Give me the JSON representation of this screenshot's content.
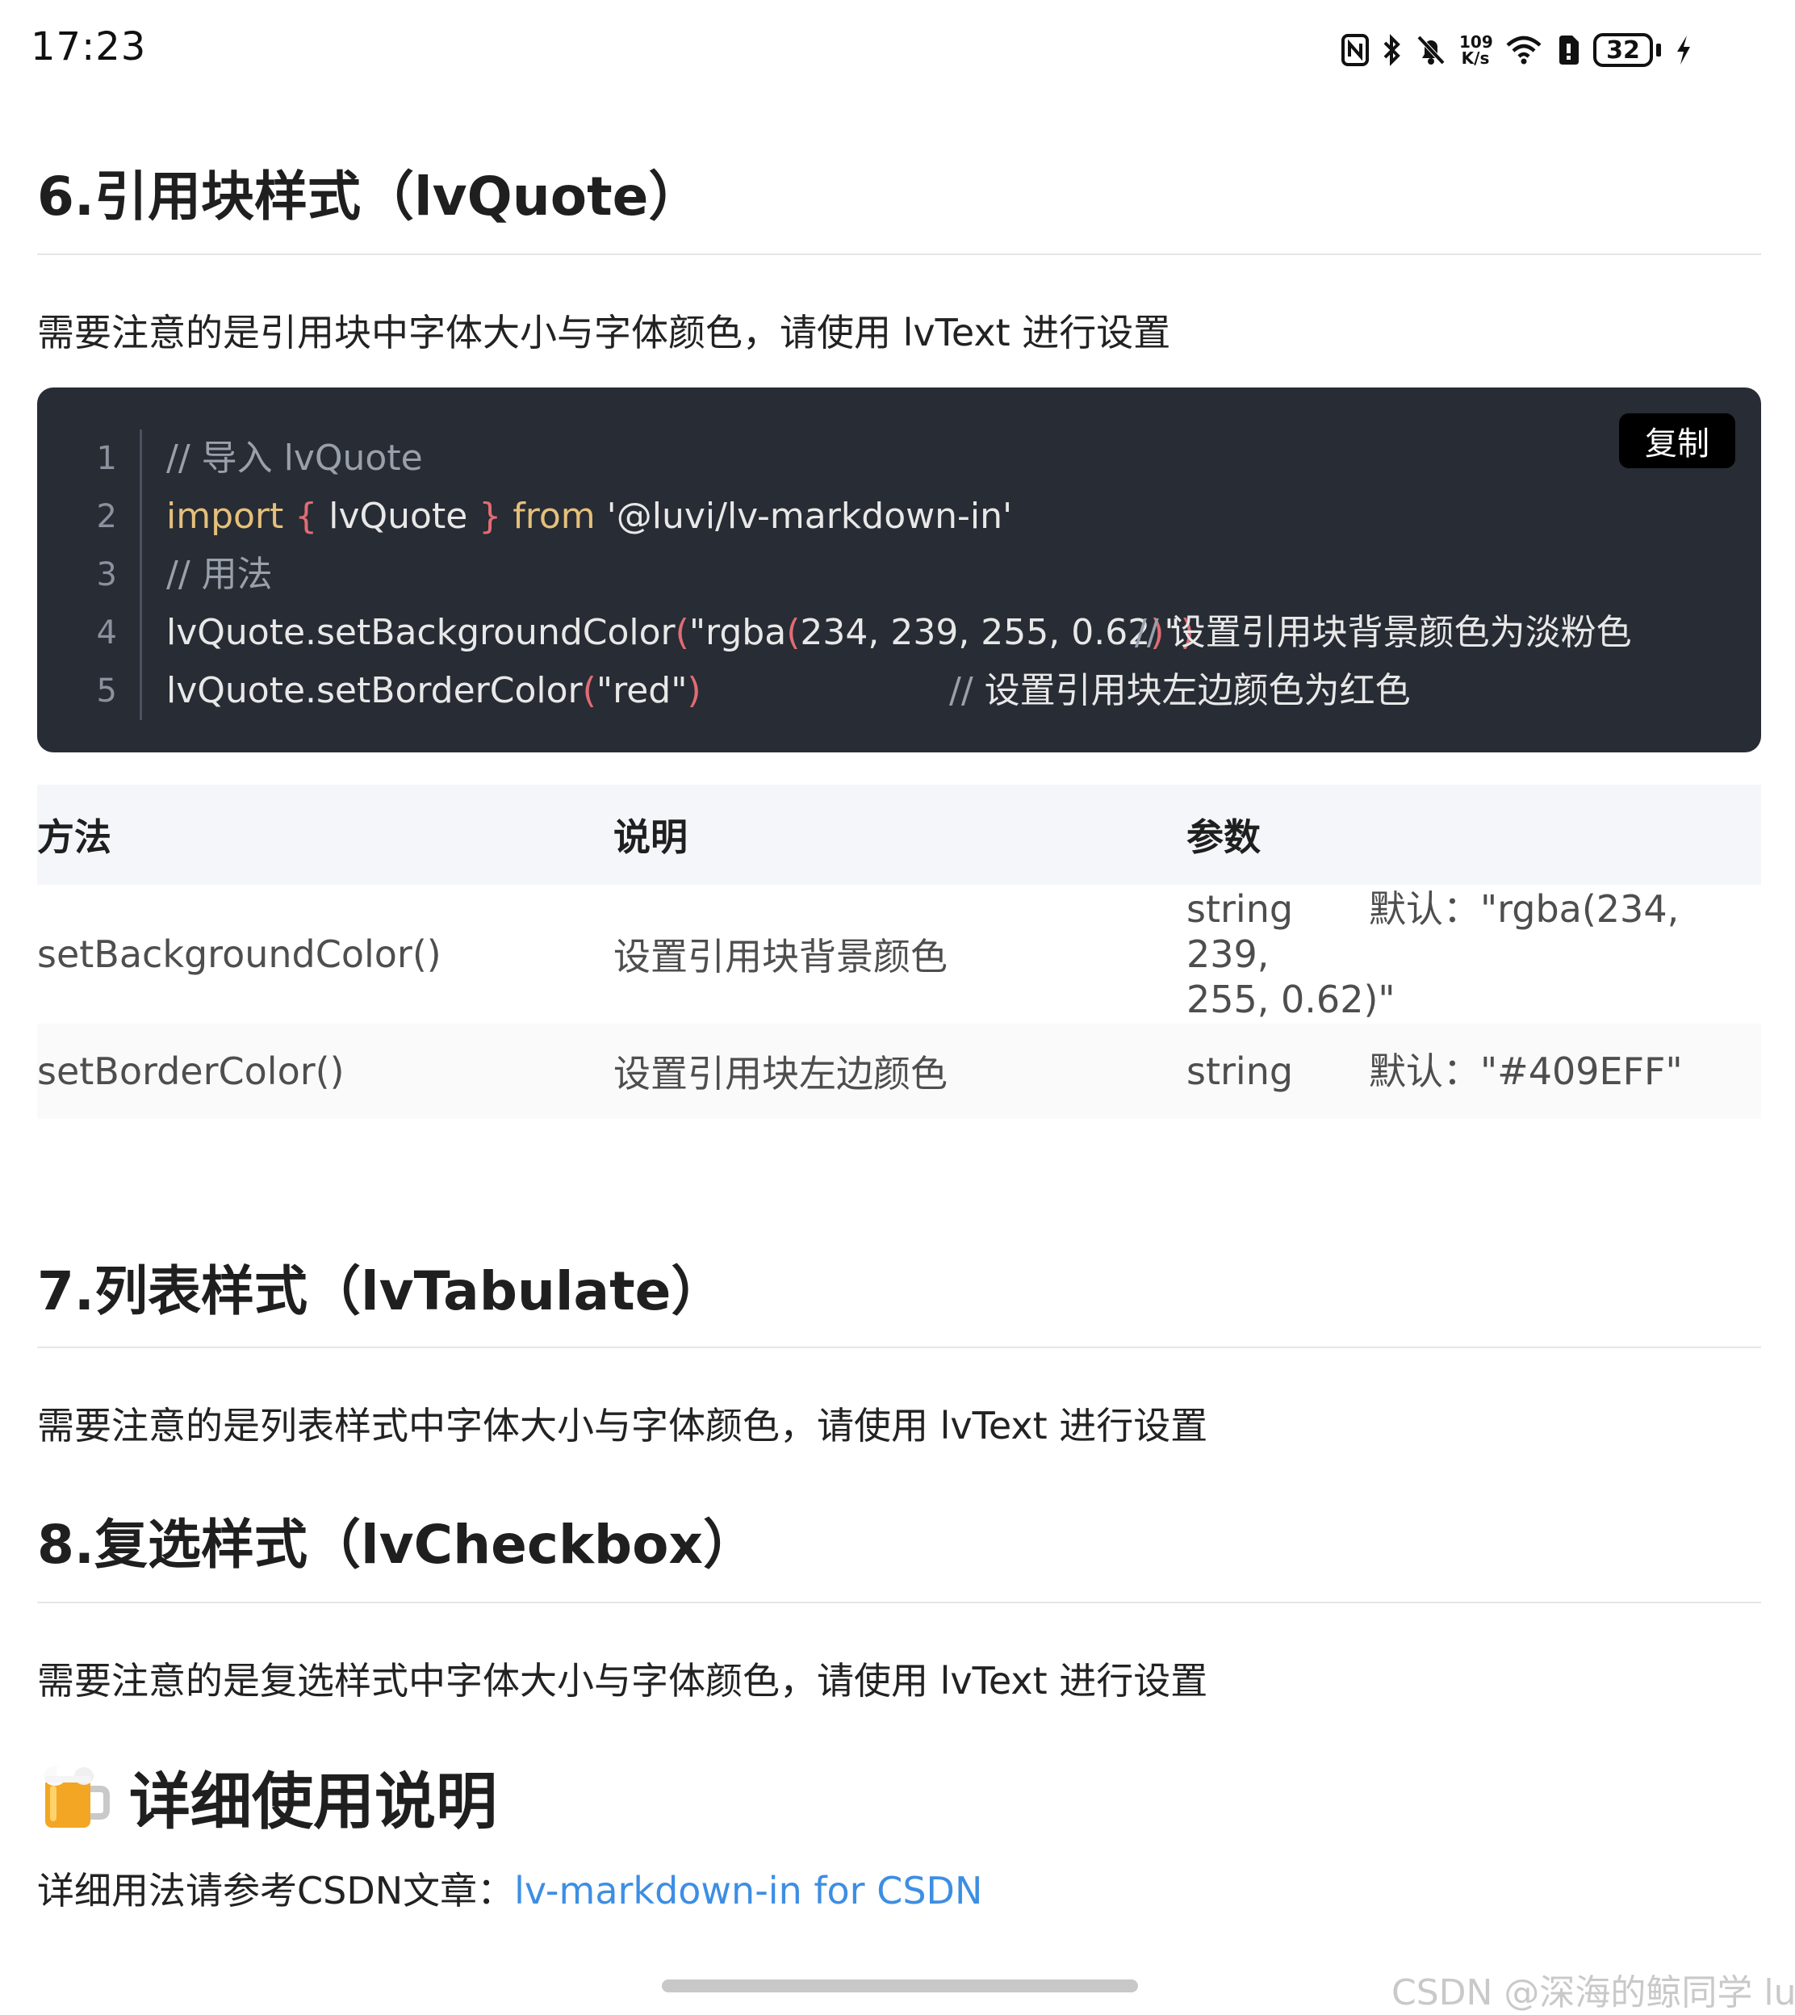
{
  "status_bar": {
    "time": "17:23",
    "net_speed_top": "109",
    "net_speed_bottom": "K/s",
    "battery": "32",
    "icons": [
      "nfc-icon",
      "bluetooth-icon",
      "mute-bell-icon",
      "wifi-icon",
      "sim-icon",
      "battery-icon",
      "charging-bolt-icon"
    ]
  },
  "section6": {
    "title": "6.引用块样式（lvQuote）",
    "note": "需要注意的是引用块中字体大小与字体颜色，请使用 lvText 进行设置"
  },
  "code": {
    "copy_label": "复制",
    "line_numbers": [
      "1",
      "2",
      "3",
      "4",
      "5"
    ],
    "line1": "// 导入 lvQuote",
    "line2": {
      "kw_import": "import",
      "brace_open": " {",
      "name": " lvQuote ",
      "brace_close": "}",
      "kw_from": " from",
      "module": " '@luvi/lv-markdown-in'"
    },
    "line3": "// 用法",
    "line4": {
      "call": "lvQuote.setBackgroundColor",
      "paren_open": "(",
      "arg_a": "\"rgba",
      "paren_inner_open": "(",
      "arg_b": "234, 239, 255, 0.62",
      "paren_inner_close": ")",
      "arg_c": "\"",
      "paren_close": ")",
      "comment_slashes": "//",
      "comment_text": " 设置引用块背景颜色为淡粉色"
    },
    "line5": {
      "call": "lvQuote.setBorderColor",
      "paren_open": "(",
      "arg": "\"red\"",
      "paren_close": ")",
      "comment_slashes": "//",
      "comment_text": " 设置引用块左边颜色为红色"
    }
  },
  "table": {
    "headers": [
      "方法",
      "说明",
      "参数"
    ],
    "rows": [
      {
        "method": "setBackgroundColor()",
        "desc": "设置引用块背景颜色",
        "param_type": "string",
        "param_default_line1": "默认：\"rgba(234, 239,",
        "param_default_line2": "255, 0.62)\""
      },
      {
        "method": "setBorderColor()",
        "desc": "设置引用块左边颜色",
        "param_type": "string",
        "param_default_line1": "默认：\"#409EFF\""
      }
    ]
  },
  "section7": {
    "title": "7.列表样式（lvTabulate）",
    "note": "需要注意的是列表样式中字体大小与字体颜色，请使用 lvText 进行设置"
  },
  "section8": {
    "title": "8.复选样式（lvCheckbox）",
    "note": "需要注意的是复选样式中字体大小与字体颜色，请使用 lvText 进行设置"
  },
  "details": {
    "emoji": "beer-mug-icon",
    "title": "详细使用说明",
    "ref_prefix": "详细用法请参考CSDN文章：",
    "ref_link": "lv-markdown-in for CSDN"
  },
  "watermark": "CSDN @深海的鲸同学 luvi"
}
